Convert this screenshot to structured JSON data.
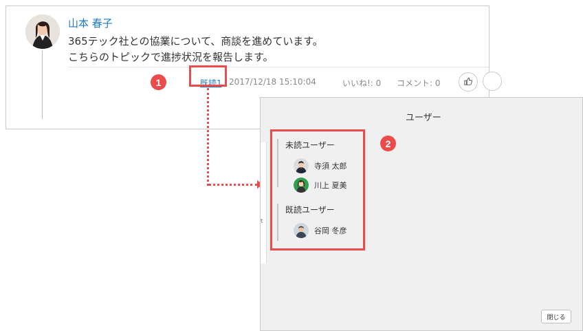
{
  "post": {
    "author": "山本 春子",
    "message_line1": "365テック社との協業について、商談を進めています。",
    "message_line2": "こちらのトピックで進捗状況を報告します。",
    "read_link": "既読1",
    "timestamp": "2017/12/18 15:10:04",
    "likes": "いいね!: 0",
    "comments": "コメント: 0"
  },
  "annotations": {
    "badge1": "1",
    "badge2": "2",
    "highlight_color": "#ec4b4b"
  },
  "dialog": {
    "title": "ユーザー",
    "unread_label": "未読ユーザー",
    "unread_users": [
      "寺須 太郎",
      "川上 夏美"
    ],
    "read_label": "既読ユーザー",
    "read_users": [
      "谷岡 冬彦"
    ],
    "close_label": "閉じる",
    "behind_snippets": [
      "t"
    ]
  },
  "icons": {
    "like": "thumbs-up-icon",
    "more": "more-icon"
  },
  "colors": {
    "link": "#1b78c4",
    "badge": "#ec4b4b"
  }
}
